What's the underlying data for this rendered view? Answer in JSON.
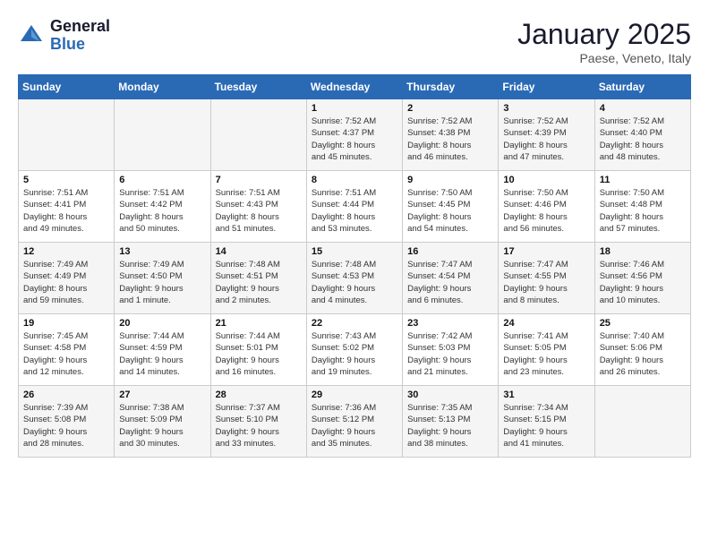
{
  "header": {
    "logo_general": "General",
    "logo_blue": "Blue",
    "month_title": "January 2025",
    "subtitle": "Paese, Veneto, Italy"
  },
  "weekdays": [
    "Sunday",
    "Monday",
    "Tuesday",
    "Wednesday",
    "Thursday",
    "Friday",
    "Saturday"
  ],
  "weeks": [
    [
      {
        "day": "",
        "info": ""
      },
      {
        "day": "",
        "info": ""
      },
      {
        "day": "",
        "info": ""
      },
      {
        "day": "1",
        "info": "Sunrise: 7:52 AM\nSunset: 4:37 PM\nDaylight: 8 hours\nand 45 minutes."
      },
      {
        "day": "2",
        "info": "Sunrise: 7:52 AM\nSunset: 4:38 PM\nDaylight: 8 hours\nand 46 minutes."
      },
      {
        "day": "3",
        "info": "Sunrise: 7:52 AM\nSunset: 4:39 PM\nDaylight: 8 hours\nand 47 minutes."
      },
      {
        "day": "4",
        "info": "Sunrise: 7:52 AM\nSunset: 4:40 PM\nDaylight: 8 hours\nand 48 minutes."
      }
    ],
    [
      {
        "day": "5",
        "info": "Sunrise: 7:51 AM\nSunset: 4:41 PM\nDaylight: 8 hours\nand 49 minutes."
      },
      {
        "day": "6",
        "info": "Sunrise: 7:51 AM\nSunset: 4:42 PM\nDaylight: 8 hours\nand 50 minutes."
      },
      {
        "day": "7",
        "info": "Sunrise: 7:51 AM\nSunset: 4:43 PM\nDaylight: 8 hours\nand 51 minutes."
      },
      {
        "day": "8",
        "info": "Sunrise: 7:51 AM\nSunset: 4:44 PM\nDaylight: 8 hours\nand 53 minutes."
      },
      {
        "day": "9",
        "info": "Sunrise: 7:50 AM\nSunset: 4:45 PM\nDaylight: 8 hours\nand 54 minutes."
      },
      {
        "day": "10",
        "info": "Sunrise: 7:50 AM\nSunset: 4:46 PM\nDaylight: 8 hours\nand 56 minutes."
      },
      {
        "day": "11",
        "info": "Sunrise: 7:50 AM\nSunset: 4:48 PM\nDaylight: 8 hours\nand 57 minutes."
      }
    ],
    [
      {
        "day": "12",
        "info": "Sunrise: 7:49 AM\nSunset: 4:49 PM\nDaylight: 8 hours\nand 59 minutes."
      },
      {
        "day": "13",
        "info": "Sunrise: 7:49 AM\nSunset: 4:50 PM\nDaylight: 9 hours\nand 1 minute."
      },
      {
        "day": "14",
        "info": "Sunrise: 7:48 AM\nSunset: 4:51 PM\nDaylight: 9 hours\nand 2 minutes."
      },
      {
        "day": "15",
        "info": "Sunrise: 7:48 AM\nSunset: 4:53 PM\nDaylight: 9 hours\nand 4 minutes."
      },
      {
        "day": "16",
        "info": "Sunrise: 7:47 AM\nSunset: 4:54 PM\nDaylight: 9 hours\nand 6 minutes."
      },
      {
        "day": "17",
        "info": "Sunrise: 7:47 AM\nSunset: 4:55 PM\nDaylight: 9 hours\nand 8 minutes."
      },
      {
        "day": "18",
        "info": "Sunrise: 7:46 AM\nSunset: 4:56 PM\nDaylight: 9 hours\nand 10 minutes."
      }
    ],
    [
      {
        "day": "19",
        "info": "Sunrise: 7:45 AM\nSunset: 4:58 PM\nDaylight: 9 hours\nand 12 minutes."
      },
      {
        "day": "20",
        "info": "Sunrise: 7:44 AM\nSunset: 4:59 PM\nDaylight: 9 hours\nand 14 minutes."
      },
      {
        "day": "21",
        "info": "Sunrise: 7:44 AM\nSunset: 5:01 PM\nDaylight: 9 hours\nand 16 minutes."
      },
      {
        "day": "22",
        "info": "Sunrise: 7:43 AM\nSunset: 5:02 PM\nDaylight: 9 hours\nand 19 minutes."
      },
      {
        "day": "23",
        "info": "Sunrise: 7:42 AM\nSunset: 5:03 PM\nDaylight: 9 hours\nand 21 minutes."
      },
      {
        "day": "24",
        "info": "Sunrise: 7:41 AM\nSunset: 5:05 PM\nDaylight: 9 hours\nand 23 minutes."
      },
      {
        "day": "25",
        "info": "Sunrise: 7:40 AM\nSunset: 5:06 PM\nDaylight: 9 hours\nand 26 minutes."
      }
    ],
    [
      {
        "day": "26",
        "info": "Sunrise: 7:39 AM\nSunset: 5:08 PM\nDaylight: 9 hours\nand 28 minutes."
      },
      {
        "day": "27",
        "info": "Sunrise: 7:38 AM\nSunset: 5:09 PM\nDaylight: 9 hours\nand 30 minutes."
      },
      {
        "day": "28",
        "info": "Sunrise: 7:37 AM\nSunset: 5:10 PM\nDaylight: 9 hours\nand 33 minutes."
      },
      {
        "day": "29",
        "info": "Sunrise: 7:36 AM\nSunset: 5:12 PM\nDaylight: 9 hours\nand 35 minutes."
      },
      {
        "day": "30",
        "info": "Sunrise: 7:35 AM\nSunset: 5:13 PM\nDaylight: 9 hours\nand 38 minutes."
      },
      {
        "day": "31",
        "info": "Sunrise: 7:34 AM\nSunset: 5:15 PM\nDaylight: 9 hours\nand 41 minutes."
      },
      {
        "day": "",
        "info": ""
      }
    ]
  ]
}
